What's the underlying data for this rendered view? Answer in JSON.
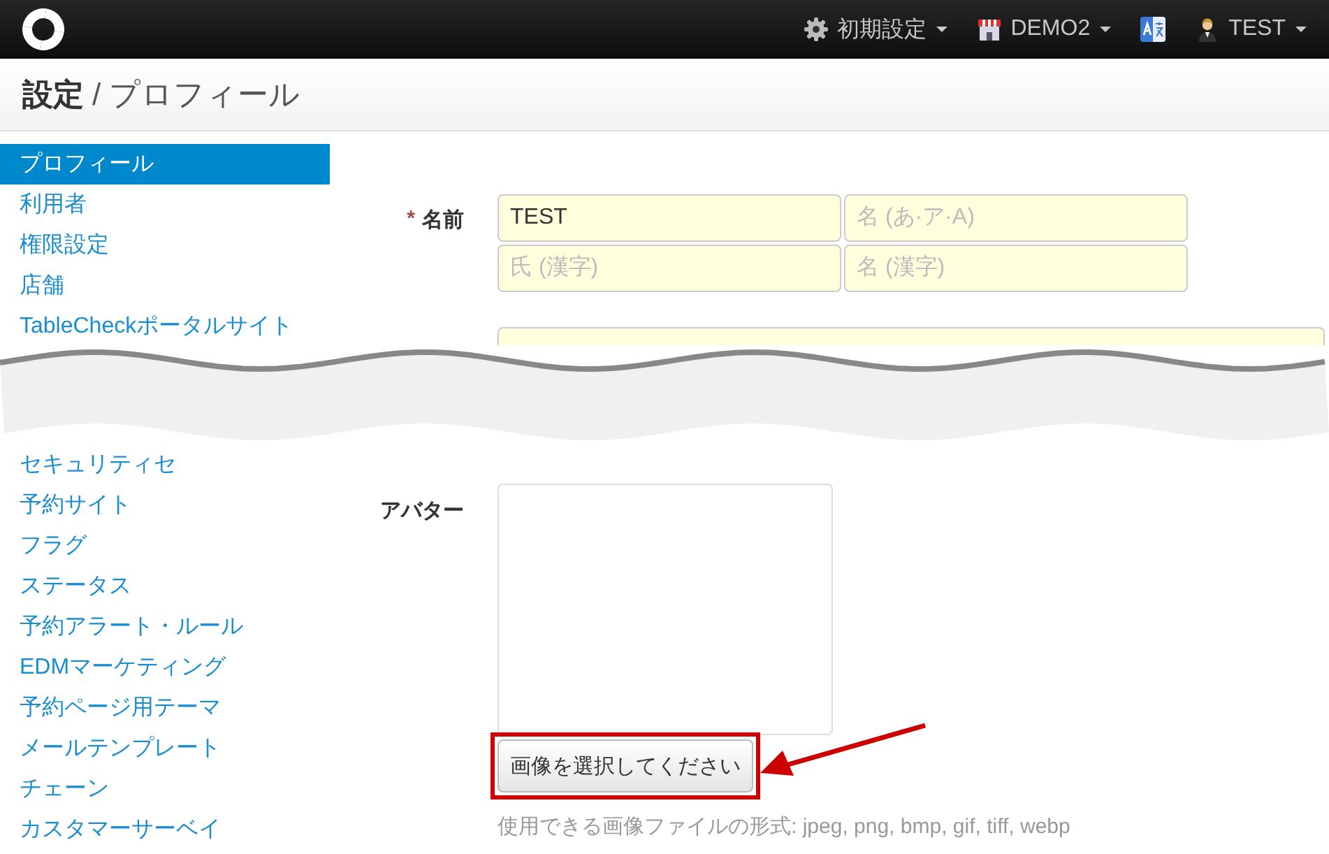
{
  "topbar": {
    "menus": [
      {
        "kind": "settings",
        "label": "初期設定"
      },
      {
        "kind": "store",
        "label": "DEMO2"
      },
      {
        "kind": "language"
      },
      {
        "kind": "user",
        "label": "TEST"
      }
    ]
  },
  "page_title": {
    "section": "設定",
    "separator": "/",
    "page": "プロフィール"
  },
  "sidebar": {
    "items": [
      {
        "label": "プロフィール",
        "selected": true
      },
      {
        "label": "利用者",
        "selected": false
      },
      {
        "label": "権限設定",
        "selected": false
      },
      {
        "label": "店舗",
        "selected": false
      },
      {
        "label": "TableCheckポータルサイト",
        "selected": false
      },
      {
        "label": "セキュリティセ",
        "selected": false,
        "after_tear": true
      },
      {
        "label": "予約サイト",
        "selected": false
      },
      {
        "label": "フラグ",
        "selected": false
      },
      {
        "label": "ステータス",
        "selected": false
      },
      {
        "label": "予約アラート・ルール",
        "selected": false
      },
      {
        "label": "EDMマーケティング",
        "selected": false
      },
      {
        "label": "予約ページ用テーマ",
        "selected": false
      },
      {
        "label": "メールテンプレート",
        "selected": false
      },
      {
        "label": "チェーン",
        "selected": false
      },
      {
        "label": "カスタマーサーベイ",
        "selected": false
      }
    ]
  },
  "form": {
    "rows": [
      {
        "kind": "name",
        "required_mark": "*",
        "label": "名前",
        "fields": [
          {
            "value": "TEST"
          },
          {
            "placeholder": "名 (あ·ア·A)"
          },
          {
            "placeholder": "氏 (漢字)"
          },
          {
            "placeholder": "名 (漢字)"
          }
        ]
      },
      {
        "kind": "input"
      },
      {
        "kind": "avatar",
        "label": "アバター",
        "button": "画像を選択してください",
        "highlighted": true,
        "hint": "使用できる画像ファイルの形式: jpeg, png, bmp, gif, tiff, webp"
      }
    ]
  }
}
